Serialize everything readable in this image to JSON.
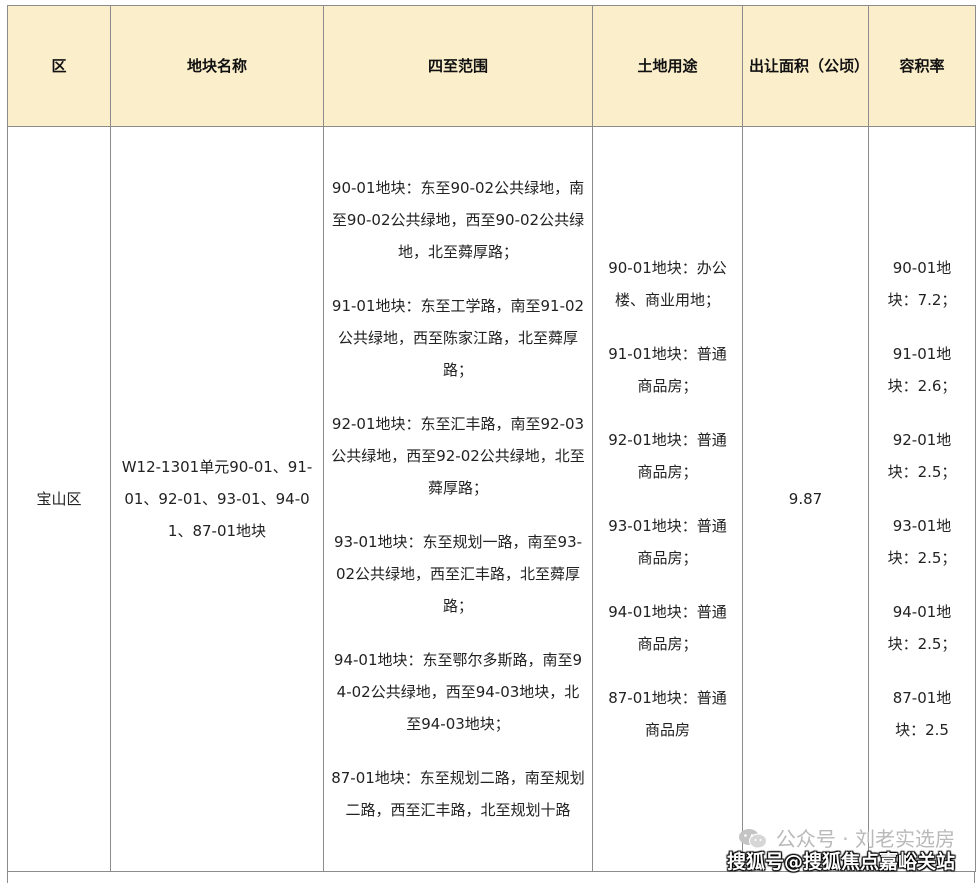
{
  "table": {
    "headers": {
      "district": "区",
      "parcel_name": "地块名称",
      "boundaries": "四至范围",
      "land_use": "土地用途",
      "area": "出让面积（公顷）",
      "far": "容积率"
    },
    "row": {
      "district": "宝山区",
      "parcel_name": "W12-1301单元90-01、91-01、92-01、93-01、94-01、87-01地块",
      "boundaries": [
        "90-01地块：东至90-02公共绿地，南至90-02公共绿地，西至90-02公共绿地，北至蕣厚路；",
        "91-01地块：东至工学路，南至91-02公共绿地，西至陈家江路，北至蕣厚路；",
        "92-01地块：东至汇丰路，南至92-03公共绿地，西至92-02公共绿地，北至蕣厚路；",
        "93-01地块：东至规划一路，南至93-02公共绿地，西至汇丰路，北至蕣厚路；",
        "94-01地块：东至鄂尔多斯路，南至94-02公共绿地，西至94-03地块，北至94-03地块；",
        "87-01地块：东至规划二路，南至规划二路，西至汇丰路，北至规划十路"
      ],
      "land_use": [
        "90-01地块：办公楼、商业用地；",
        "91-01地块：普通商品房；",
        "92-01地块：普通商品房；",
        "93-01地块：普通商品房；",
        "94-01地块：普通商品房；",
        "87-01地块：普通商品房"
      ],
      "area": "9.87",
      "far": [
        "90-01地块：7.2；",
        "91-01地块：2.6；",
        "92-01地块：2.5；",
        "93-01地块：2.5；",
        "94-01地块：2.5；",
        "87-01地块：2.5"
      ]
    }
  },
  "watermark": {
    "line1": "公众号 · 刘老实选房",
    "line2": "搜狐号@搜狐焦点嘉峪关站",
    "icon": "wechat-icon"
  },
  "colors": {
    "header_bg": "#fbeecb",
    "border": "#8c8c8c"
  }
}
